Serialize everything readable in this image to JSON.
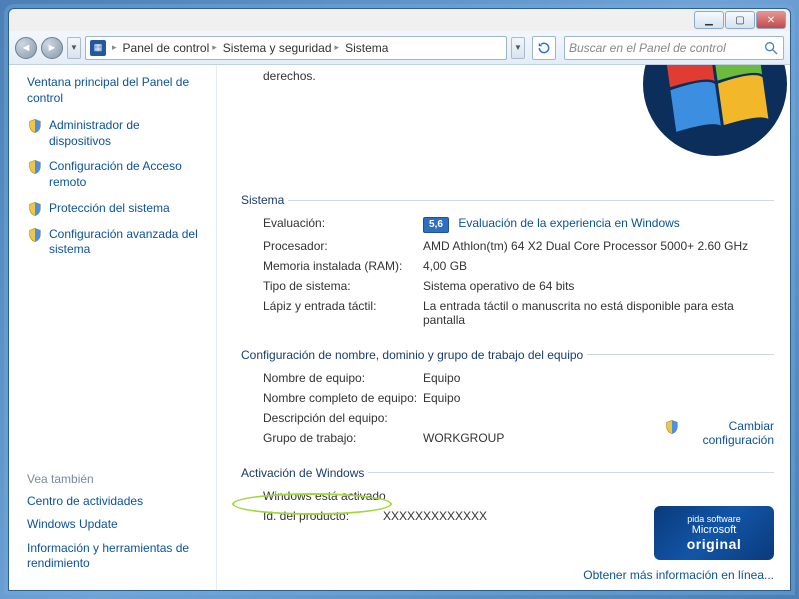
{
  "window": {
    "min_tip": "Minimizar",
    "max_tip": "Maximizar",
    "close_tip": "Cerrar"
  },
  "nav": {
    "back_tip": "Atrás",
    "fwd_tip": "Adelante",
    "history_tip": "Historial"
  },
  "breadcrumb": {
    "root": "Panel de control",
    "seg1": "Sistema y seguridad",
    "seg2": "Sistema"
  },
  "search": {
    "placeholder": "Buscar en el Panel de control"
  },
  "sidebar": {
    "main": "Ventana principal del Panel de control",
    "items": [
      "Administrador de dispositivos",
      "Configuración de Acceso remoto",
      "Protección del sistema",
      "Configuración avanzada del sistema"
    ],
    "see_also_header": "Vea también",
    "see_also": [
      "Centro de actividades",
      "Windows Update",
      "Información y herramientas de rendimiento"
    ]
  },
  "main": {
    "top_fragment": "derechos.",
    "sections": {
      "system": {
        "legend": "Sistema",
        "rows": {
          "rating_label": "Evaluación:",
          "rating_badge": "5,6",
          "rating_link": "Evaluación de la experiencia en Windows",
          "cpu_label": "Procesador:",
          "cpu_value": "AMD Athlon(tm) 64 X2 Dual Core Processor 5000+   2.60 GHz",
          "ram_label": "Memoria instalada (RAM):",
          "ram_value": "4,00 GB",
          "type_label": "Tipo de sistema:",
          "type_value": "Sistema operativo de 64 bits",
          "pen_label": "Lápiz y entrada táctil:",
          "pen_value": "La entrada táctil o manuscrita no está disponible para esta pantalla"
        }
      },
      "network": {
        "legend": "Configuración de nombre, dominio y grupo de trabajo del equipo",
        "rows": {
          "name_label": "Nombre de equipo:",
          "name_value": "Equipo",
          "full_label": "Nombre completo de equipo:",
          "full_value": "Equipo",
          "desc_label": "Descripción del equipo:",
          "desc_value": "",
          "wg_label": "Grupo de trabajo:",
          "wg_value": "WORKGROUP"
        },
        "change_link": "Cambiar configuración"
      },
      "activation": {
        "legend": "Activación de Windows",
        "status": "Windows está activado",
        "pid_label": "Id. del producto:",
        "pid_value": "XXXXXXXXXXXXX",
        "genuine_small": "pida software",
        "genuine_brand": "Microsoft",
        "genuine_big": "original",
        "more_info": "Obtener más información en línea..."
      }
    }
  }
}
